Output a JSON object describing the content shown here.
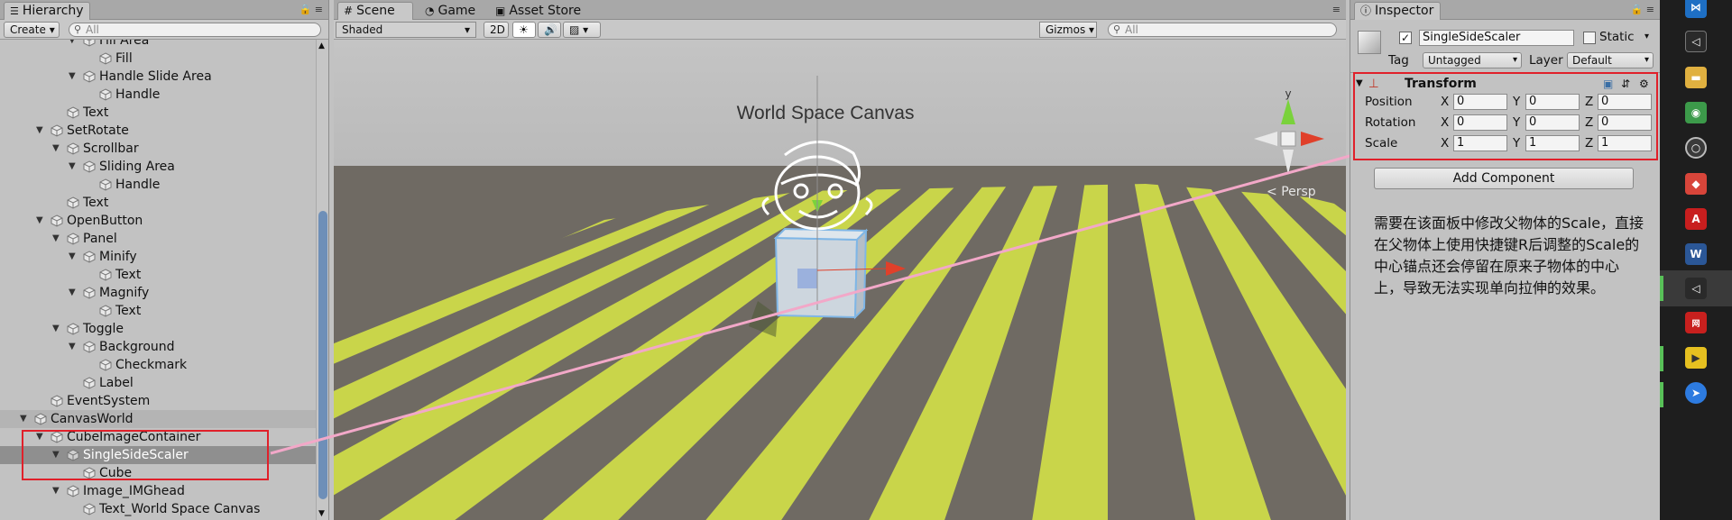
{
  "hierarchy": {
    "tab_label": "Hierarchy",
    "create_label": "Create",
    "search_placeholder": "All",
    "items": [
      {
        "label": "Fill Area",
        "depth": 3,
        "expanded": true
      },
      {
        "label": "Fill",
        "depth": 4,
        "expanded": null
      },
      {
        "label": "Handle Slide Area",
        "depth": 3,
        "expanded": true
      },
      {
        "label": "Handle",
        "depth": 4,
        "expanded": null
      },
      {
        "label": "Text",
        "depth": 2,
        "expanded": null
      },
      {
        "label": "SetRotate",
        "depth": 1,
        "expanded": true
      },
      {
        "label": "Scrollbar",
        "depth": 2,
        "expanded": true
      },
      {
        "label": "Sliding Area",
        "depth": 3,
        "expanded": true
      },
      {
        "label": "Handle",
        "depth": 4,
        "expanded": null
      },
      {
        "label": "Text",
        "depth": 2,
        "expanded": null
      },
      {
        "label": "OpenButton",
        "depth": 1,
        "expanded": true
      },
      {
        "label": "Panel",
        "depth": 2,
        "expanded": true
      },
      {
        "label": "Minify",
        "depth": 3,
        "expanded": true
      },
      {
        "label": "Text",
        "depth": 4,
        "expanded": null
      },
      {
        "label": "Magnify",
        "depth": 3,
        "expanded": true
      },
      {
        "label": "Text",
        "depth": 4,
        "expanded": null
      },
      {
        "label": "Toggle",
        "depth": 2,
        "expanded": true
      },
      {
        "label": "Background",
        "depth": 3,
        "expanded": true
      },
      {
        "label": "Checkmark",
        "depth": 4,
        "expanded": null
      },
      {
        "label": "Label",
        "depth": 3,
        "expanded": null
      },
      {
        "label": "EventSystem",
        "depth": 1,
        "expanded": null
      },
      {
        "label": "CanvasWorld",
        "depth": 0,
        "expanded": true,
        "scene": true
      },
      {
        "label": "CubeImageContainer",
        "depth": 1,
        "expanded": true
      },
      {
        "label": "SingleSideScaler",
        "depth": 2,
        "expanded": true,
        "selected": true
      },
      {
        "label": "Cube",
        "depth": 3,
        "expanded": null
      },
      {
        "label": "Image_IMGhead",
        "depth": 2,
        "expanded": true
      },
      {
        "label": "Text_World Space Canvas",
        "depth": 3,
        "expanded": null
      }
    ]
  },
  "scene": {
    "tabs": [
      {
        "label": "Scene",
        "icon": "grid-icon",
        "active": true
      },
      {
        "label": "Game",
        "icon": "pacman-icon",
        "active": false
      },
      {
        "label": "Asset Store",
        "icon": "bag-icon",
        "active": false
      }
    ],
    "shading_mode": "Shaded",
    "mode_2d": "2D",
    "gizmos_label": "Gizmos",
    "search_placeholder": "All",
    "canvas_title": "World Space Canvas",
    "persp_label": "Persp",
    "gizmo_axis_label": "y",
    "colors": {
      "stripe": "#c9d54a",
      "ground": "#706b64",
      "sky": "#b2b2b2"
    }
  },
  "inspector": {
    "tab_label": "Inspector",
    "object_name": "SingleSideScaler",
    "static_label": "Static",
    "tag_label": "Tag",
    "tag_value": "Untagged",
    "layer_label": "Layer",
    "layer_value": "Default",
    "component_title": "Transform",
    "rows": [
      {
        "label": "Position",
        "x": "0",
        "y": "0",
        "z": "0"
      },
      {
        "label": "Rotation",
        "x": "0",
        "y": "0",
        "z": "0"
      },
      {
        "label": "Scale",
        "x": "1",
        "y": "1",
        "z": "1"
      }
    ],
    "axis_labels": {
      "x": "X",
      "y": "Y",
      "z": "Z"
    },
    "add_component_label": "Add Component",
    "note": "需要在该面板中修改父物体的Scale，直接在父物体上使用快捷键R后调整的Scale的中心锚点还会停留在原来子物体的中心上，导致无法实现单向拉伸的效果。"
  },
  "taskbar": {
    "apps": [
      "vscode-icon",
      "unity-icon",
      "folder-icon",
      "android-icon",
      "chrome-icon",
      "git-icon",
      "pdf-icon",
      "word-icon",
      "unity-icon",
      "netease-icon",
      "player-icon",
      "feishu-icon"
    ]
  },
  "annotation_color": "#e0202a"
}
